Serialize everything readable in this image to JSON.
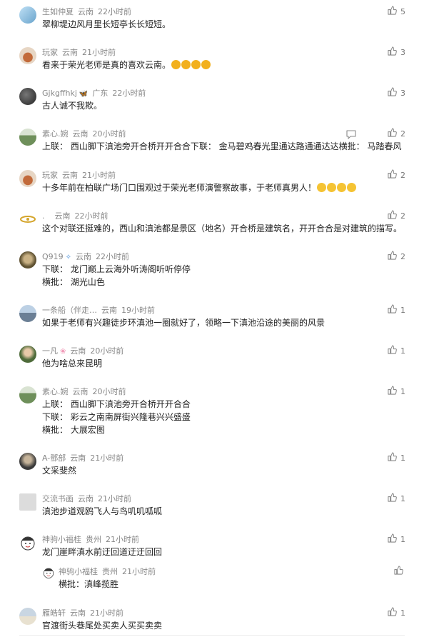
{
  "comments": [
    {
      "name": "生如仲夏",
      "loc": "云南",
      "time": "22小时前",
      "likes": "5",
      "lines": [
        "翠柳堤边风月里长短亭长长短短。"
      ],
      "avatar_color": "#7fb3d6"
    },
    {
      "name": "玩家",
      "loc": "云南",
      "time": "21小时前",
      "likes": "3",
      "lines": [
        "看来于荣光老师是真的喜欢云南。"
      ],
      "emoji_count": 4,
      "avatar_color": "#c26a3a"
    },
    {
      "name": "Gjkgffhkj",
      "badge": "🦋",
      "loc": "广东",
      "time": "22小时前",
      "likes": "3",
      "lines": [
        "古人诚不我欺。"
      ],
      "avatar_color": "#3c3c3c"
    },
    {
      "name": "素心.婉",
      "loc": "云南",
      "time": "20小时前",
      "likes": "2",
      "has_reply_icon": true,
      "lines": [
        "上联：   西山脚下滇池旁开合桥开开合合下联：   金马碧鸡春光里通达路通通达达横批：   马踏春风"
      ],
      "avatar_color": "#8fa98a"
    },
    {
      "name": "玩家",
      "loc": "云南",
      "time": "21小时前",
      "likes": "2",
      "lines": [
        "十多年前在柏联广场门口围观过于荣光老师演警察故事，于老师真男人！"
      ],
      "emoji_count": 4,
      "avatar_color": "#c26a3a"
    },
    {
      "name": ".",
      "loc": "云南",
      "time": "22小时前",
      "likes": "2",
      "lines": [
        "这个对联还挺难的，西山和滇池都是景区（地名）开合桥是建筑名，开开合合是对建筑的描写。"
      ],
      "avatar_color": "#d4b03a"
    },
    {
      "name": "Q919",
      "badge": "✧",
      "loc": "云南",
      "time": "22小时前",
      "likes": "2",
      "lines": [
        "下联：   龙门巅上云海外听涛阁听听停停",
        "横批：   湖光山色"
      ],
      "avatar_color": "#8a7a4a"
    },
    {
      "name": "一条船（伴走…",
      "loc": "云南",
      "time": "19小时前",
      "likes": "1",
      "lines": [
        "如果于老师有兴趣徒步环滇池一圈就好了，领略一下滇池沿途的美丽的风景"
      ],
      "avatar_color": "#7a8fa5"
    },
    {
      "name": "一凡",
      "badge": "❀",
      "loc": "云南",
      "time": "20小时前",
      "likes": "1",
      "lines": [
        "他为啥总来昆明"
      ],
      "avatar_color": "#6d8f52"
    },
    {
      "name": "素心.婉",
      "loc": "云南",
      "time": "20小时前",
      "likes": "1",
      "lines": [
        "上联：   西山脚下滇池旁开合桥开开合合",
        "下联：   彩云之南南屏街兴隆巷兴兴盛盛",
        "横批：   大展宏图"
      ],
      "avatar_color": "#8fa98a"
    },
    {
      "name": "A-鄧部",
      "loc": "云南",
      "time": "21小时前",
      "likes": "1",
      "lines": [
        "文采斐然"
      ],
      "avatar_color": "#555"
    },
    {
      "name": "交流书画",
      "loc": "云南",
      "time": "21小时前",
      "likes": "1",
      "lines": [
        "滇池步道观鸥飞人与鸟叽叽呱呱"
      ],
      "avatar_color": "#d9d9d9"
    },
    {
      "name": "神驹小福桂",
      "loc": "贵州",
      "time": "21小时前",
      "likes": "1",
      "lines": [
        "龙门崖畔滇水前迂回道迂迂回回"
      ],
      "avatar_color": "#f3f3f3"
    },
    {
      "name": "雁皓轩",
      "loc": "云南",
      "time": "21小时前",
      "likes": "1",
      "lines": [
        "官渡街头巷尾处买卖人买买卖卖"
      ],
      "avatar_color": "#b8c4cf"
    }
  ],
  "reply": {
    "name": "神驹小福桂",
    "loc": "贵州",
    "time": "21小时前",
    "lines": [
      "横批：滇峰揽胜"
    ]
  }
}
